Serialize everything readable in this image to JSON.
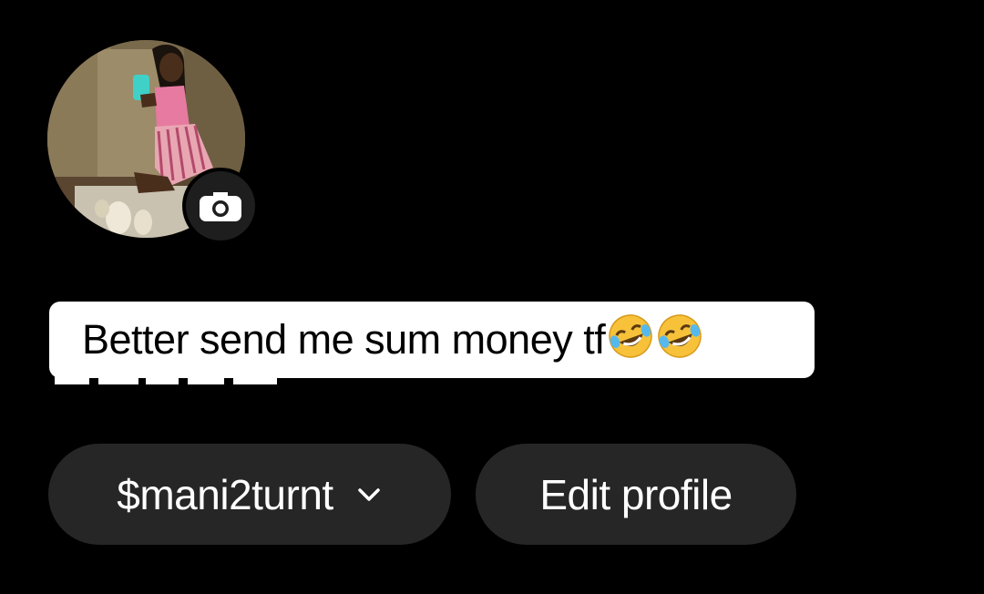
{
  "profile": {
    "avatar_alt": "profile photo",
    "camera_icon": "camera-icon"
  },
  "caption": {
    "text": "Better send me sum money tf",
    "emoji": [
      "rolling-on-floor-laughing-emoji",
      "rolling-on-floor-laughing-emoji"
    ]
  },
  "actions": {
    "username_label": "$mani2turnt",
    "username_icon": "chevron-down-icon",
    "edit_label": "Edit profile"
  },
  "colors": {
    "background": "#000000",
    "pill_background": "#262626",
    "caption_background": "#ffffff",
    "caption_text": "#000000"
  }
}
